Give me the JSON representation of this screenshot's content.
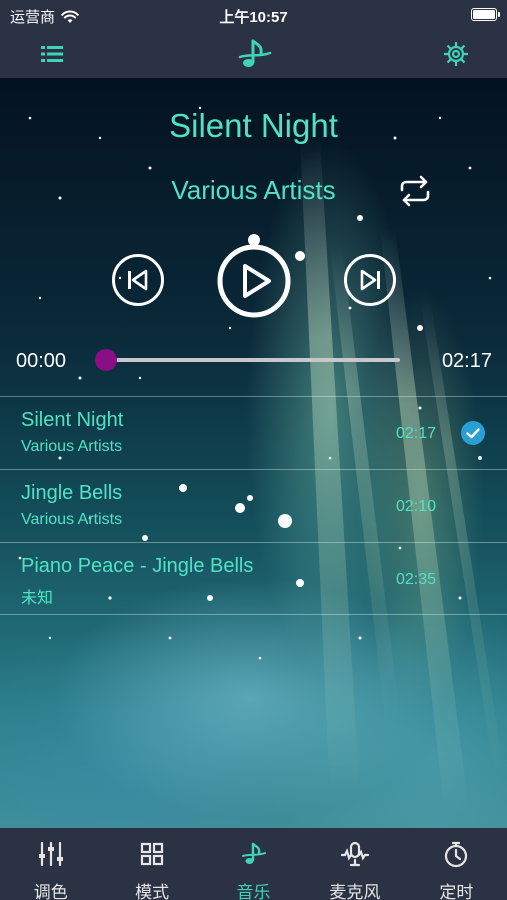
{
  "status_bar": {
    "carrier": "运营商",
    "time": "上午10:57"
  },
  "nav": {
    "left_icon": "list-icon",
    "center_icon": "music-note-icon",
    "right_icon": "settings-gear-icon"
  },
  "now_playing": {
    "title": "Silent Night",
    "artist": "Various Artists",
    "elapsed": "00:00",
    "duration": "02:17",
    "progress": 0.0
  },
  "playlist": [
    {
      "title": "Silent Night",
      "artist": "Various Artists",
      "duration": "02:17",
      "selected": true
    },
    {
      "title": "Jingle Bells",
      "artist": "Various Artists",
      "duration": "02:10",
      "selected": false
    },
    {
      "title": "Piano Peace - Jingle Bells",
      "artist": "未知",
      "duration": "02:35",
      "selected": false
    }
  ],
  "tabs": [
    {
      "label": "调色",
      "icon": "sliders-icon",
      "active": false
    },
    {
      "label": "模式",
      "icon": "grid-icon",
      "active": false
    },
    {
      "label": "音乐",
      "icon": "music-note-icon",
      "active": true
    },
    {
      "label": "麦克风",
      "icon": "microphone-icon",
      "active": false
    },
    {
      "label": "定时",
      "icon": "timer-icon",
      "active": false
    }
  ],
  "colors": {
    "accent": "#4fe3c4",
    "bar_bg": "#2b3244",
    "progress_thumb": "#8a0f86",
    "check": "#2a9fd6"
  }
}
